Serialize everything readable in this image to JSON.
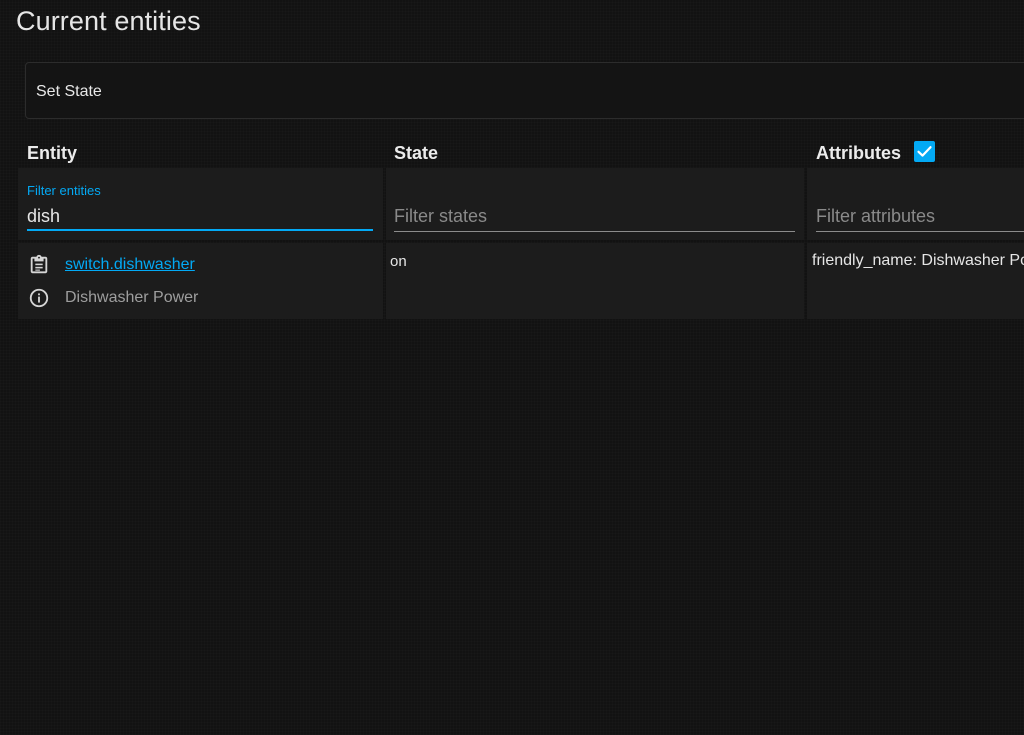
{
  "page": {
    "title": "Current entities"
  },
  "set_state": {
    "label": "Set State"
  },
  "table": {
    "headers": {
      "entity": "Entity",
      "state": "State",
      "attributes": "Attributes"
    },
    "attributes_checkbox_checked": true,
    "filters": {
      "entity": {
        "label": "Filter entities",
        "value": "dish"
      },
      "state": {
        "placeholder": "Filter states",
        "value": ""
      },
      "attributes": {
        "placeholder": "Filter attributes",
        "value": ""
      }
    },
    "rows": [
      {
        "entity_id": "switch.dishwasher",
        "friendly_name": "Dishwasher Power",
        "state": "on",
        "attributes": "friendly_name: Dishwasher Power"
      }
    ]
  },
  "icons": {
    "copy": "clipboard-list-icon",
    "info": "info-circle-icon",
    "check": "checkmark-icon"
  },
  "colors": {
    "accent": "#03a9f4",
    "background": "#121212",
    "cell": "#1c1c1c",
    "text": "#e1e1e1",
    "muted": "#9e9e9e"
  }
}
